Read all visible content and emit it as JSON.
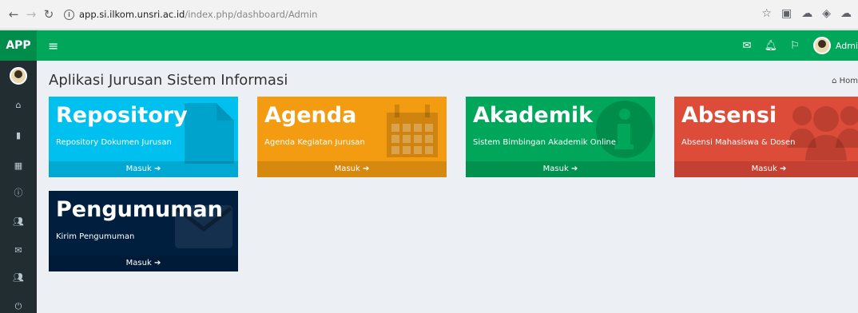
{
  "browser": {
    "url_host": "app.si.ilkom.unsri.ac.id",
    "url_path": "/index.php/dashboard/Admin"
  },
  "header": {
    "logo": "APP",
    "user_name": "Admi"
  },
  "page": {
    "title": "Aplikasi Jurusan Sistem Informasi",
    "breadcrumb": "Hom"
  },
  "cards": [
    {
      "title": "Repository",
      "desc": "Repository Dokumen Jurusan",
      "link": "Masuk",
      "color": "#00c0ef",
      "icon": "file-icon"
    },
    {
      "title": "Agenda",
      "desc": "Agenda Kegiatan Jurusan",
      "link": "Masuk",
      "color": "#f39c12",
      "icon": "calendar-icon"
    },
    {
      "title": "Akademik",
      "desc": "Sistem Bimbingan Akademik Online",
      "link": "Masuk",
      "color": "#00a65a",
      "icon": "info-icon"
    },
    {
      "title": "Absensi",
      "desc": "Absensi Mahasiswa & Dosen",
      "link": "Masuk",
      "color": "#dd4b39",
      "icon": "users-icon"
    },
    {
      "title": "Pengumuman",
      "desc": "Kirim Pengumuman",
      "link": "Masuk",
      "color": "#001f3f",
      "icon": "envelope-icon"
    }
  ],
  "sidebar_icons": [
    "home-icon",
    "file-icon",
    "calendar-icon",
    "info-icon",
    "users-icon",
    "envelope-icon",
    "users-icon",
    "power-icon"
  ]
}
